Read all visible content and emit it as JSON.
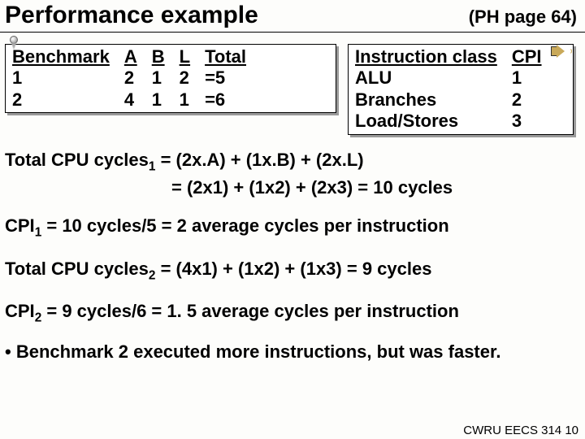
{
  "header": {
    "title": "Performance example",
    "ref": "(PH page 64)"
  },
  "bench_table": {
    "headers": [
      "Benchmark",
      "A",
      "B",
      "L",
      "Total"
    ],
    "rows": [
      [
        "1",
        "2",
        "1",
        "2",
        "=5"
      ],
      [
        "2",
        "4",
        "1",
        "1",
        "=6"
      ]
    ]
  },
  "instr_table": {
    "headers": [
      "Instruction class",
      "CPI"
    ],
    "rows": [
      [
        "ALU",
        "1"
      ],
      [
        "Branches",
        "2"
      ],
      [
        "Load/Stores",
        "3"
      ]
    ]
  },
  "calc": {
    "l1_label": "Total CPU cycles",
    "l1_sub": "1",
    "l1a": " = (2x.A) + (1x.B) + (2x.L)",
    "l1b": "= (2x1) + (1x2) + (2x3) = 10 cycles",
    "l2_label": "CPI",
    "l2_sub": "1",
    "l2_rest": " = 10 cycles/5 = 2 average cycles per instruction",
    "l3_label": "Total CPU cycles",
    "l3_sub": "2",
    "l3_rest": " = (4x1) + (1x2) + (1x3) = 9 cycles",
    "l4_label": "CPI",
    "l4_sub": "2",
    "l4_rest": " = 9 cycles/6 = 1. 5 average cycles per instruction"
  },
  "bullet": "• Benchmark 2 executed more instructions, but was faster.",
  "footer": "CWRU EECS 314   10"
}
